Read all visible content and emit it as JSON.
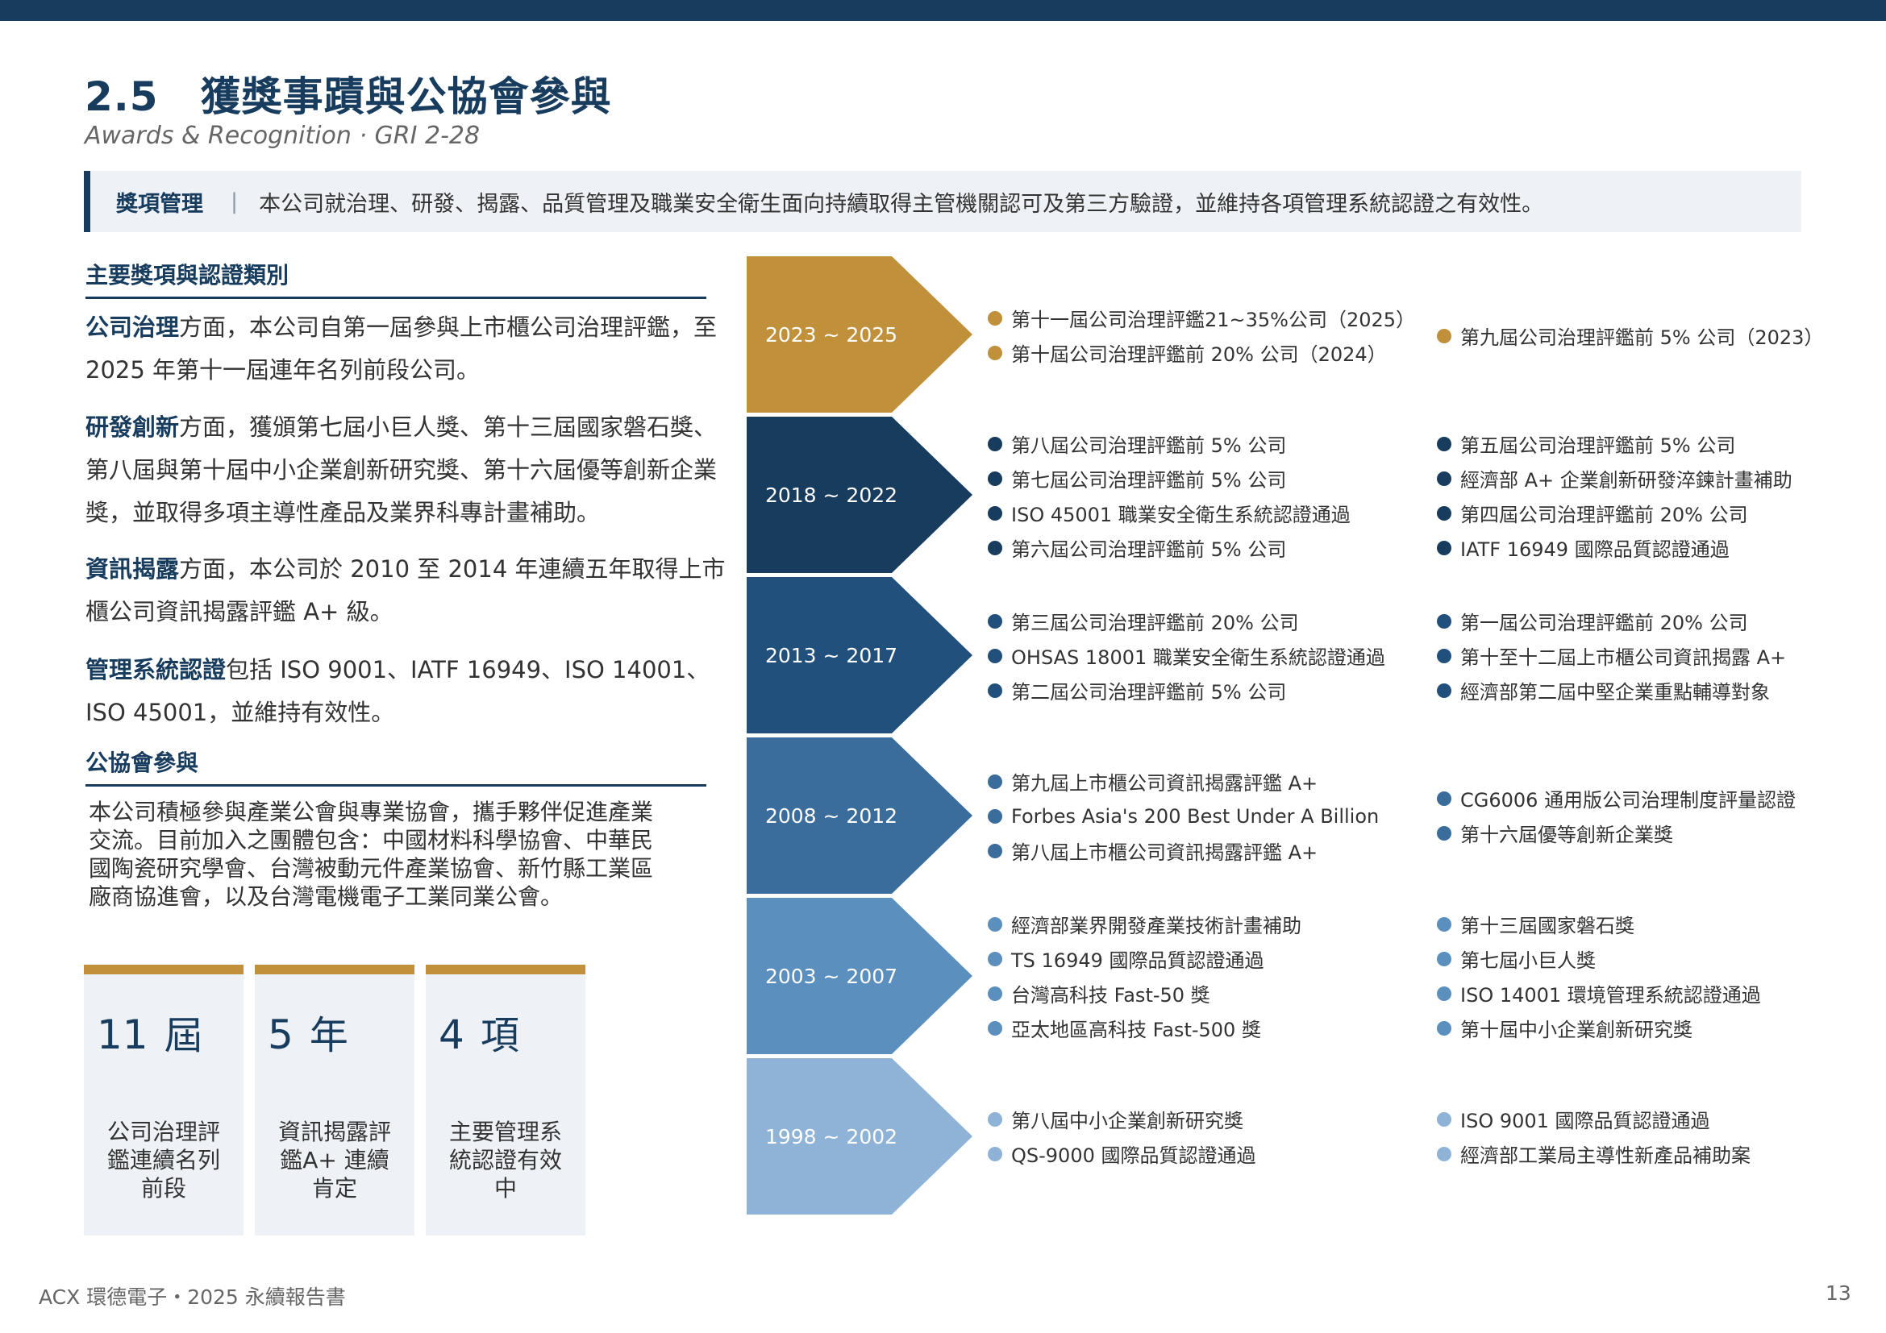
{
  "header": {
    "section_number": "2.5",
    "title": "獲獎事蹟與公協會參與",
    "subtitle": "Awards & Recognition · GRI 2-28"
  },
  "banner": {
    "label": "獎項管理",
    "separator": "|",
    "text": "本公司就治理、研發、揭露、品質管理及職業安全衛生面向持續取得主管機關認可及第三方驗證，並維持各項管理系統認證之有效性。"
  },
  "awards_section": {
    "heading": "主要獎項與認證類別",
    "paragraphs": [
      {
        "lead": "公司治理",
        "text": "方面，本公司自第一屆參與上市櫃公司治理評鑑，至 2025 年第十一屆連年名列前段公司。"
      },
      {
        "lead": "研發創新",
        "text": "方面，獲頒第七屆小巨人獎、第十三屆國家磐石獎、第八屆與第十屆中小企業創新研究獎、第十六屆優等創新企業獎，並取得多項主導性產品及業界科專計畫補助。"
      },
      {
        "lead": "資訊揭露",
        "text": "方面，本公司於 2010 至 2014 年連續五年取得上市櫃公司資訊揭露評鑑 A+ 級。"
      },
      {
        "lead": "管理系統認證",
        "text": "包括 ISO 9001、IATF 16949、ISO 14001、ISO 45001，並維持有效性。"
      }
    ]
  },
  "association_section": {
    "heading": "公協會參與",
    "text": "本公司積極參與產業公會與專業協會，攜手夥伴促進產業交流。目前加入之團體包含：中國材料科學協會、中華民國陶瓷研究學會、台灣被動元件產業協會、新竹縣工業區廠商協進會，以及台灣電機電子工業同業公會。"
  },
  "stats": [
    {
      "number": "11",
      "unit": "屆",
      "label": "公司治理評鑑連續名列前段"
    },
    {
      "number": "5",
      "unit": "年",
      "label": "資訊揭露評鑑A+ 連續肯定"
    },
    {
      "number": "4",
      "unit": "項",
      "label": "主要管理系統認證有效中"
    }
  ],
  "timeline": [
    {
      "range": "2023 ~ 2025",
      "color": "#c0903a",
      "left": [
        "第十一屆公司治理評鑑21~35%公司（2025）",
        "第十屆公司治理評鑑前 20% 公司（2024）"
      ],
      "right": [
        "第九屆公司治理評鑑前 5% 公司（2023）"
      ]
    },
    {
      "range": "2018 ~ 2022",
      "color": "#173c5e",
      "left": [
        "第八屆公司治理評鑑前 5% 公司",
        "第七屆公司治理評鑑前 5% 公司",
        "ISO 45001 職業安全衛生系統認證通過",
        "第六屆公司治理評鑑前 5% 公司"
      ],
      "right": [
        "第五屆公司治理評鑑前 5% 公司",
        "經濟部 A+ 企業創新研發淬鍊計畫補助",
        "第四屆公司治理評鑑前 20% 公司",
        "IATF 16949 國際品質認證通過"
      ]
    },
    {
      "range": "2013 ~ 2017",
      "color": "#22507c",
      "left": [
        "第三屆公司治理評鑑前 20% 公司",
        "OHSAS 18001 職業安全衛生系統認證通過",
        "第二屆公司治理評鑑前 5% 公司"
      ],
      "right": [
        "第一屆公司治理評鑑前 20% 公司",
        "第十至十二屆上市櫃公司資訊揭露 A+",
        "經濟部第二屆中堅企業重點輔導對象"
      ]
    },
    {
      "range": "2008 ~ 2012",
      "color": "#3a6d9c",
      "left": [
        "第九屆上市櫃公司資訊揭露評鑑 A+",
        "Forbes Asia's 200 Best Under A Billion",
        "第八屆上市櫃公司資訊揭露評鑑 A+"
      ],
      "right": [
        "CG6006 通用版公司治理制度評量認證",
        "第十六屆優等創新企業獎"
      ]
    },
    {
      "range": "2003 ~ 2007",
      "color": "#5b8fbd",
      "left": [
        "經濟部業界開發產業技術計畫補助",
        "TS 16949 國際品質認證通過",
        "台灣高科技 Fast-50 獎",
        "亞太地區高科技 Fast-500 獎"
      ],
      "right": [
        "第十三屆國家磐石獎",
        "第七屆小巨人獎",
        "ISO 14001 環境管理系統認證通過",
        "第十屆中小企業創新研究獎"
      ]
    },
    {
      "range": "1998 ~ 2002",
      "color": "#8fb3d6",
      "left": [
        "第八屆中小企業創新研究獎",
        "QS-9000 國際品質認證通過"
      ],
      "right": [
        "ISO 9001 國際品質認證通過",
        "經濟部工業局主導性新產品補助案"
      ]
    }
  ],
  "footer": {
    "text": "ACX 環德電子・2025 永續報告書",
    "page": "13"
  }
}
